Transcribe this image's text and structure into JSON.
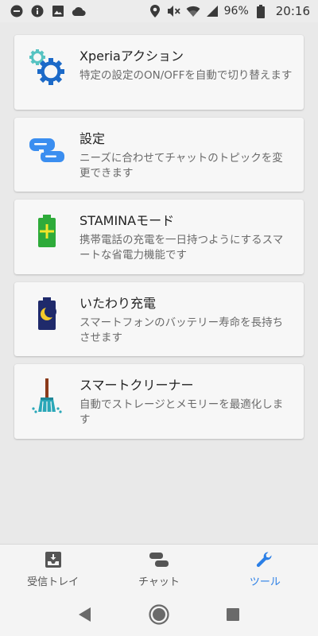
{
  "status_bar": {
    "battery_percent": "96%",
    "time": "20:16",
    "icons": [
      "do-not-disturb-icon",
      "info-icon",
      "image-icon",
      "cloud-icon",
      "location-icon",
      "mute-icon",
      "wifi-icon",
      "signal-icon",
      "battery-icon"
    ]
  },
  "cards": [
    {
      "title": "Xperiaアクション",
      "desc": "特定の設定のON/OFFを自動で切り替えます",
      "icon": "gears-icon"
    },
    {
      "title": "設定",
      "desc": "ニーズに合わせてチャットのトピックを変更できます",
      "icon": "chat-bubbles-icon"
    },
    {
      "title": "STAMINAモード",
      "desc": "携帯電話の充電を一日持つようにするスマートな省電力機能です",
      "icon": "stamina-battery-icon"
    },
    {
      "title": "いたわり充電",
      "desc": "スマートフォンのバッテリー寿命を長持ちさせます",
      "icon": "moon-battery-icon"
    },
    {
      "title": "スマートクリーナー",
      "desc": "自動でストレージとメモリーを最適化します",
      "icon": "broom-icon"
    }
  ],
  "bottom_nav": {
    "items": [
      {
        "label": "受信トレイ",
        "icon": "inbox-icon",
        "active": false
      },
      {
        "label": "チャット",
        "icon": "chat-icon",
        "active": false
      },
      {
        "label": "ツール",
        "icon": "wrench-icon",
        "active": true
      }
    ]
  },
  "colors": {
    "accent": "#2b7fe6",
    "stamina_green": "#2eab3a",
    "battery_navy": "#1f2a6b",
    "moon_yellow": "#f3c92a",
    "broom_teal": "#2aa7b8",
    "broom_brown": "#8b3a1a"
  }
}
